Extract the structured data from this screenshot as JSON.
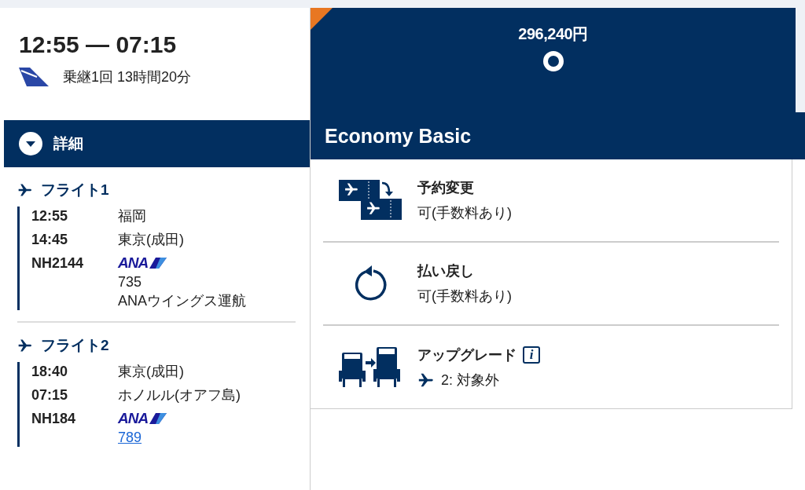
{
  "itinerary": {
    "times": "12:55 — 07:15",
    "summary": "乗継1回 13時間20分"
  },
  "details_toggle": {
    "label": "詳細",
    "expanded": true
  },
  "flights": [
    {
      "title": "フライト1",
      "segments": [
        {
          "time": "12:55",
          "place": "福岡"
        },
        {
          "time": "14:45",
          "place": "東京(成田)"
        }
      ],
      "number": "NH2144",
      "airline_logo": "ANA",
      "aircraft": "735",
      "aircraft_link": false,
      "operator": "ANAウイングス運航"
    },
    {
      "title": "フライト2",
      "segments": [
        {
          "time": "18:40",
          "place": "東京(成田)"
        },
        {
          "time": "07:15",
          "place": "ホノルル(オアフ島)"
        }
      ],
      "number": "NH184",
      "airline_logo": "ANA",
      "aircraft": "789",
      "aircraft_link": true
    }
  ],
  "fare": {
    "price": "296,240円",
    "selected": true,
    "name": "Economy Basic"
  },
  "features": [
    {
      "kind": "change",
      "title": "予約変更",
      "detail": "可(手数料あり)",
      "info": false,
      "flight_icon": false
    },
    {
      "kind": "refund",
      "title": "払い戻し",
      "detail": "可(手数料あり)",
      "info": false,
      "flight_icon": false
    },
    {
      "kind": "upgrade",
      "title": "アップグレード",
      "detail": "2: 対象外",
      "info": true,
      "info_label": "i",
      "flight_icon": true
    }
  ]
}
